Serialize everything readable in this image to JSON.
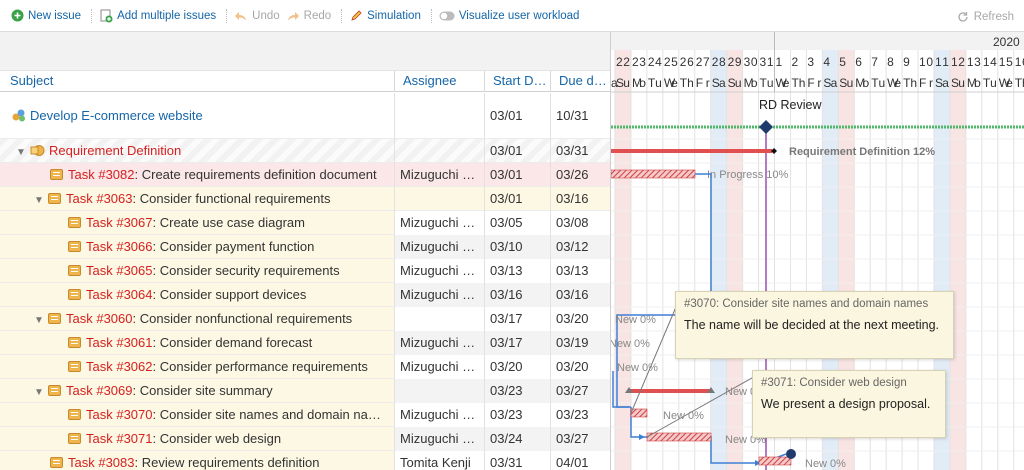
{
  "toolbar": {
    "new_issue": "New issue",
    "add_multiple": "Add multiple issues",
    "undo": "Undo",
    "redo": "Redo",
    "simulation": "Simulation",
    "workload": "Visualize user workload",
    "refresh": "Refresh"
  },
  "columns": {
    "subject": "Subject",
    "assignee": "Assignee",
    "start": "Start D…",
    "due": "Due d…"
  },
  "project": {
    "name": "Develop E-commerce website",
    "start": "03/01",
    "due": "10/31"
  },
  "rows": [
    {
      "id": "",
      "title": "Requirement Definition",
      "assignee": "",
      "start": "03/01",
      "due": "03/31"
    },
    {
      "id": "Task #3082",
      "title": ": Create requirements definition document",
      "assignee": "Mizuguchi …",
      "start": "03/01",
      "due": "03/26"
    },
    {
      "id": "Task #3063",
      "title": ": Consider functional requirements",
      "assignee": "",
      "start": "03/01",
      "due": "03/16"
    },
    {
      "id": "Task #3067",
      "title": ": Create use case diagram",
      "assignee": "Mizuguchi …",
      "start": "03/05",
      "due": "03/08"
    },
    {
      "id": "Task #3066",
      "title": ": Consider payment function",
      "assignee": "Mizuguchi …",
      "start": "03/10",
      "due": "03/12"
    },
    {
      "id": "Task #3065",
      "title": ": Consider security requirements",
      "assignee": "Mizuguchi …",
      "start": "03/13",
      "due": "03/13"
    },
    {
      "id": "Task #3064",
      "title": ": Consider support devices",
      "assignee": "Mizuguchi …",
      "start": "03/16",
      "due": "03/16"
    },
    {
      "id": "Task #3060",
      "title": ": Consider nonfunctional requirements",
      "assignee": "",
      "start": "03/17",
      "due": "03/20"
    },
    {
      "id": "Task #3061",
      "title": ": Consider demand forecast",
      "assignee": "Mizuguchi …",
      "start": "03/17",
      "due": "03/19"
    },
    {
      "id": "Task #3062",
      "title": ": Consider performance requirements",
      "assignee": "Mizuguchi …",
      "start": "03/20",
      "due": "03/20"
    },
    {
      "id": "Task #3069",
      "title": ": Consider site summary",
      "assignee": "",
      "start": "03/23",
      "due": "03/27"
    },
    {
      "id": "Task #3070",
      "title": ": Consider site names and domain na…",
      "assignee": "Mizuguchi …",
      "start": "03/23",
      "due": "03/23"
    },
    {
      "id": "Task #3071",
      "title": ": Consider web design",
      "assignee": "Mizuguchi …",
      "start": "03/24",
      "due": "03/27"
    },
    {
      "id": "Task #3083",
      "title": ": Review requirements definition",
      "assignee": "Tomita Kenji",
      "start": "03/31",
      "due": "04/01"
    }
  ],
  "gantt": {
    "year": "2020",
    "days": [
      "22",
      "23",
      "24",
      "25",
      "26",
      "27",
      "28",
      "29",
      "30",
      "31",
      "1",
      "2",
      "3",
      "4",
      "5",
      "6",
      "7",
      "8",
      "9",
      "10",
      "11",
      "12",
      "13",
      "14",
      "15",
      "16"
    ],
    "weekdays": [
      "Su",
      "Mo",
      "Tu",
      "We",
      "Th",
      "Fr",
      "Sa",
      "Su",
      "Mo",
      "Tu",
      "We",
      "Th",
      "Fr",
      "Sa",
      "Su",
      "Mo",
      "Tu",
      "We",
      "Th",
      "Fr",
      "Sa",
      "Su",
      "Mo",
      "Tu",
      "We",
      "Th"
    ],
    "weekday_partial": "a",
    "milestone": "RD Review",
    "parent_label": "Requirement Definition 12%",
    "task_label": "In Progress 10%",
    "new_labels": [
      "New 0%",
      "New 0%",
      "New 0%",
      "New 0%",
      "New 0%",
      "New 0%",
      "New 0%",
      "New 0%"
    ]
  },
  "tooltips": [
    {
      "title": "#3070: Consider site names and domain names",
      "body": "The name will be decided at the next meeting."
    },
    {
      "title": "#3071: Consider web design",
      "body": "We present a design proposal."
    }
  ],
  "colors": {
    "link": "#1565a8",
    "task_red": "#d62020",
    "bar_red": "#e05050",
    "progress_green": "#3caa5a",
    "dependency_blue": "#3f7fd6",
    "milestone_navy": "#1f3a6b"
  }
}
